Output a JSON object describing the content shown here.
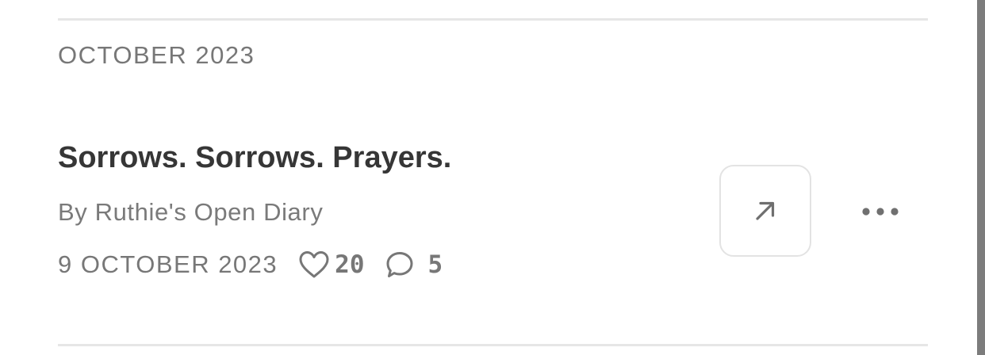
{
  "section": {
    "title": "OCTOBER 2023"
  },
  "post": {
    "title": "Sorrows. Sorrows. Prayers.",
    "byline": "By Ruthie's Open Diary",
    "date": "9 OCTOBER 2023",
    "likes": "20",
    "comments": "5"
  },
  "icons": {
    "like": "heart-icon",
    "comment": "speech-bubble-icon",
    "share": "arrow-up-right-icon",
    "more": "ellipsis-icon"
  },
  "colors": {
    "text_primary": "#363636",
    "text_secondary": "#777777",
    "divider": "#e6e6e6",
    "button_border": "#e3e3e3"
  }
}
